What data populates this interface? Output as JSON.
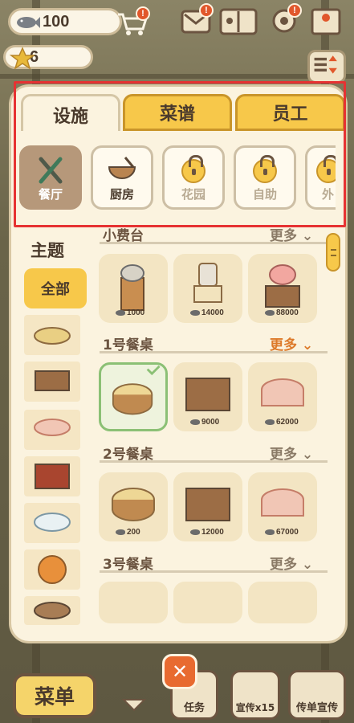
{
  "currency": {
    "fish": "100",
    "stars": "6"
  },
  "tabs": [
    {
      "label": "设施",
      "active": true
    },
    {
      "label": "菜谱",
      "active": false
    },
    {
      "label": "员工",
      "active": false
    }
  ],
  "categories": [
    {
      "label": "餐厅",
      "icon": "tools-icon",
      "state": "active"
    },
    {
      "label": "厨房",
      "icon": "bowl-icon",
      "state": "normal"
    },
    {
      "label": "花园",
      "icon": "lock-icon",
      "state": "locked"
    },
    {
      "label": "自助",
      "icon": "lock-icon",
      "state": "locked"
    },
    {
      "label": "外",
      "icon": "lock-icon",
      "state": "locked"
    }
  ],
  "themes": {
    "title": "主题",
    "all": "全部"
  },
  "sections": [
    {
      "title": "小费台",
      "more": "更多",
      "prices": [
        "1000",
        "14000",
        "88000"
      ]
    },
    {
      "title": "1号餐桌",
      "more": "更多",
      "prices": [
        "",
        "9000",
        "62000"
      ]
    },
    {
      "title": "2号餐桌",
      "more": "更多",
      "prices": [
        "200",
        "12000",
        "67000"
      ]
    },
    {
      "title": "3号餐桌",
      "more": "更多",
      "prices": [
        "",
        "",
        ""
      ]
    }
  ],
  "bottom": {
    "menu": "菜单",
    "close": "✕",
    "task": "任务",
    "promote": "宣传x15",
    "flyer": "传单宣传"
  },
  "colors": {
    "accent": "#f7c84a",
    "highlight": "#e63232",
    "panel": "#fbf3df"
  }
}
